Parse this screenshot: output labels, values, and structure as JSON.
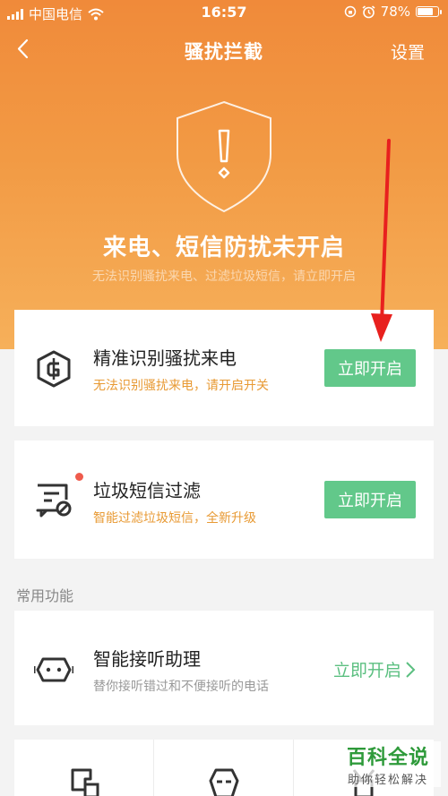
{
  "status_bar": {
    "carrier": "中国电信",
    "time": "16:57",
    "battery": "78%",
    "battery_level": 0.78
  },
  "nav": {
    "title": "骚扰拦截",
    "settings_label": "设置"
  },
  "hero": {
    "title": "来电、短信防扰未开启",
    "subtitle": "无法识别骚扰来电、过滤垃圾短信，请立即开启"
  },
  "cards": [
    {
      "title": "精准识别骚扰来电",
      "desc": "无法识别骚扰来电，请开启开关",
      "action": "立即开启",
      "icon": "shield-g-icon"
    },
    {
      "title": "垃圾短信过滤",
      "desc": "智能过滤垃圾短信，全新升级",
      "action": "立即开启",
      "icon": "message-block-icon"
    }
  ],
  "section": {
    "label": "常用功能"
  },
  "assistant": {
    "title": "智能接听助理",
    "desc": "替你接听错过和不便接听的电话",
    "action": "立即开启",
    "icon": "robot-assistant-icon"
  },
  "watermark": {
    "big": "百科全说",
    "small": "助你轻松解决"
  },
  "colors": {
    "hero_orange": "#f08a3a",
    "accent_green": "#62c88a",
    "desc_orange": "#e89a34",
    "notify_red": "#ef5b4c",
    "arrow_red": "#e8201e"
  }
}
